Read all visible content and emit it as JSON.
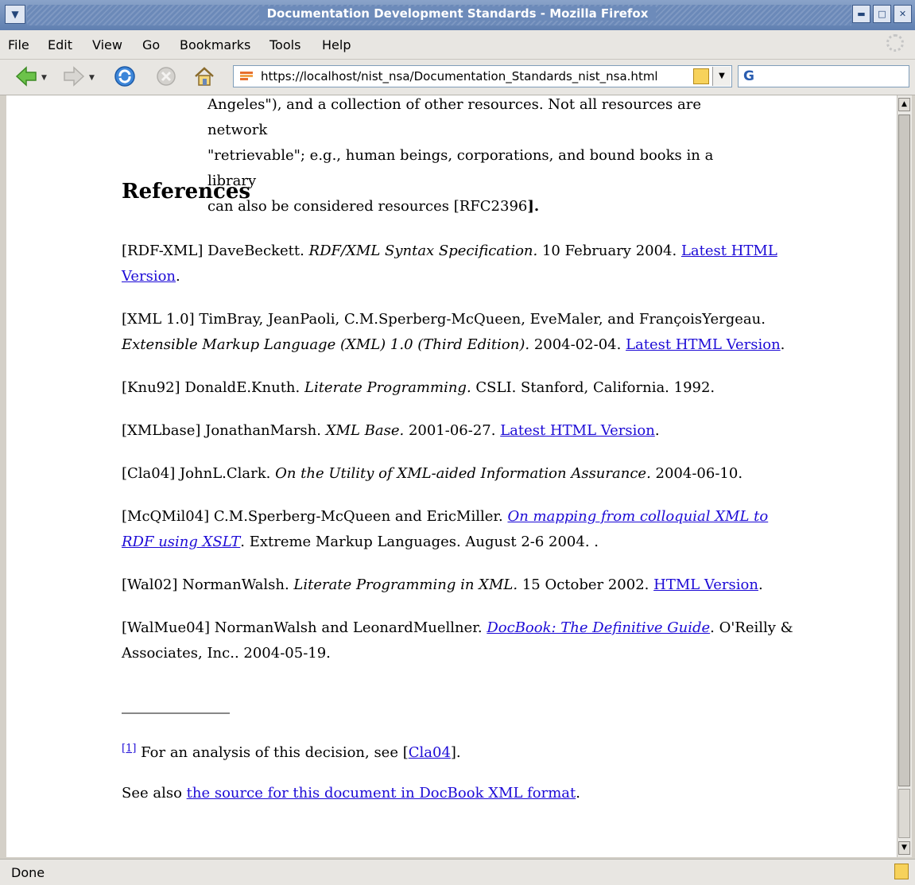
{
  "window": {
    "title": "Documentation Development Standards - Mozilla Firefox"
  },
  "menu": [
    "File",
    "Edit",
    "View",
    "Go",
    "Bookmarks",
    "Tools",
    "Help"
  ],
  "toolbar": {
    "url": "https://localhost/nist_nsa/Documentation_Standards_nist_nsa.html",
    "search_engine_letter": "G"
  },
  "content": {
    "cont_line_cut": "Angeles\"), and a collection of other resources. Not all resources are network",
    "cont_line2": "\"retrievable\"; e.g., human beings, corporations, and bound books in a library",
    "cont_line3_pre": "can also be considered resources [RFC2396",
    "cont_line3_post": "].",
    "references_heading": "References",
    "refs": {
      "rdfxml": {
        "tag": "[RDF-XML]",
        "authors": "DaveBeckett.",
        "title": "RDF/XML Syntax Specification.",
        "rest": "10 February 2004.",
        "link": "Latest HTML Version",
        "end": "."
      },
      "xml10": {
        "tag": "[XML 1.0]",
        "authors": "TimBray, JeanPaoli, C.M.Sperberg-McQueen, EveMaler, and FrançoisYergeau.",
        "title": "Extensible Markup Language (XML) 1.0 (Third Edition).",
        "rest": "2004-02-04.",
        "link": "Latest HTML Version",
        "end": "."
      },
      "knu92": {
        "tag": "[Knu92]",
        "authors": "DonaldE.Knuth.",
        "title": "Literate Programming.",
        "rest": "CSLI. Stanford, California. 1992."
      },
      "xmlbase": {
        "tag": "[XMLbase]",
        "authors": "JonathanMarsh.",
        "title": "XML Base.",
        "rest": "2001-06-27.",
        "link": "Latest HTML Version",
        "end": "."
      },
      "cla04": {
        "tag": "[Cla04]",
        "authors": "JohnL.Clark.",
        "title": "On the Utility of XML-aided Information Assurance.",
        "rest": "2004-06-10."
      },
      "mcqmil04": {
        "tag": "[McQMil04]",
        "authors": "C.M.Sperberg-McQueen and EricMiller.",
        "link": "On mapping from colloquial XML to RDF using XSLT",
        "rest": ". Extreme Markup Languages. August 2-6 2004. ."
      },
      "wal02": {
        "tag": "[Wal02]",
        "authors": "NormanWalsh.",
        "title": "Literate Programming in XML.",
        "rest": "15 October 2002.",
        "link": "HTML Version",
        "end": "."
      },
      "walmue04": {
        "tag": "[WalMue04]",
        "authors": "NormanWalsh and LeonardMuellner.",
        "link": "DocBook: The Definitive Guide",
        "rest": ". O'Reilly & Associates, Inc.. 2004-05-19."
      }
    },
    "footnote": {
      "marker": "[1]",
      "text": "For an analysis of this decision, see [",
      "link": "Cla04",
      "end": "]."
    },
    "see_also": {
      "pre": "See also ",
      "link": "the source for this document in DocBook XML format",
      "end": "."
    }
  },
  "status": {
    "text": "Done"
  }
}
